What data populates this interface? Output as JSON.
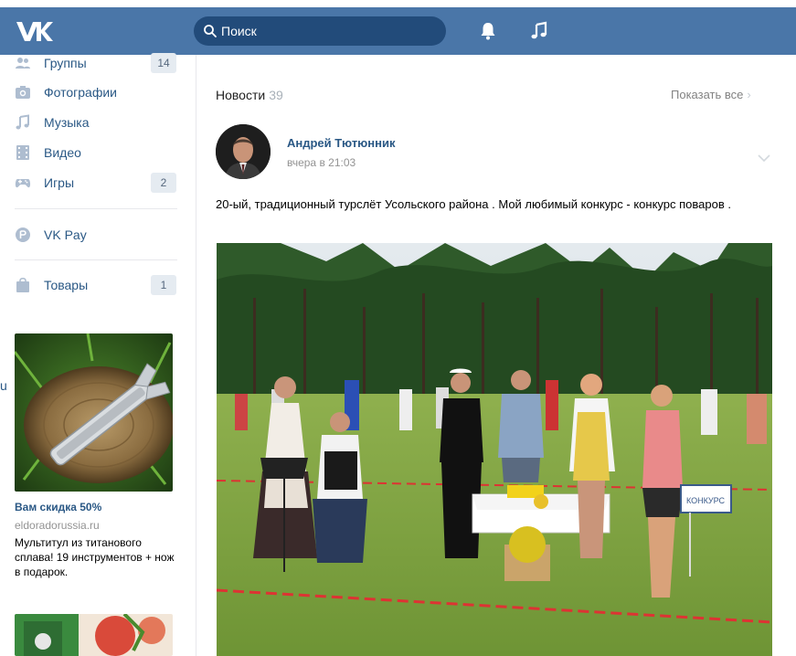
{
  "header": {
    "logo": "VK",
    "logo_icon": "vk-logo",
    "search_placeholder": "Поиск",
    "icons": [
      "bell-icon",
      "music-note-icon"
    ],
    "color": "#4a76a8"
  },
  "sidebar": {
    "items": [
      {
        "label": "Группы",
        "count": "14",
        "icon": "groups-icon"
      },
      {
        "label": "Фотографии",
        "icon": "camera-icon"
      },
      {
        "label": "Музыка",
        "icon": "music-note-icon"
      },
      {
        "label": "Видео",
        "icon": "film-icon"
      },
      {
        "label": "Игры",
        "count": "2",
        "icon": "gamepad-icon"
      },
      {
        "label": "VK Pay",
        "icon": "vkpay-icon"
      },
      {
        "label": "Товары",
        "count": "1",
        "icon": "shopping-bag-icon"
      }
    ],
    "stray_char": "u"
  },
  "ad": {
    "title": "Вам скидка 50%",
    "domain": "eldoradorussia.ru",
    "text": "Мультитул из титанового сплава! 19 инструментов + нож в подарок."
  },
  "feed": {
    "title": "Новости",
    "count": "39",
    "show_all": "Показать все"
  },
  "post": {
    "author": "Андрей Тютюнник",
    "time": "вчера в 21:03",
    "text": "20-ый, традиционный турслёт Усольского района . Мой любимый конкурс - конкурс поваров .",
    "sign_text": "КОНКУРС"
  },
  "colors": {
    "link": "#2a5885",
    "muted": "#939393",
    "badge_bg": "#e5ebf1"
  }
}
